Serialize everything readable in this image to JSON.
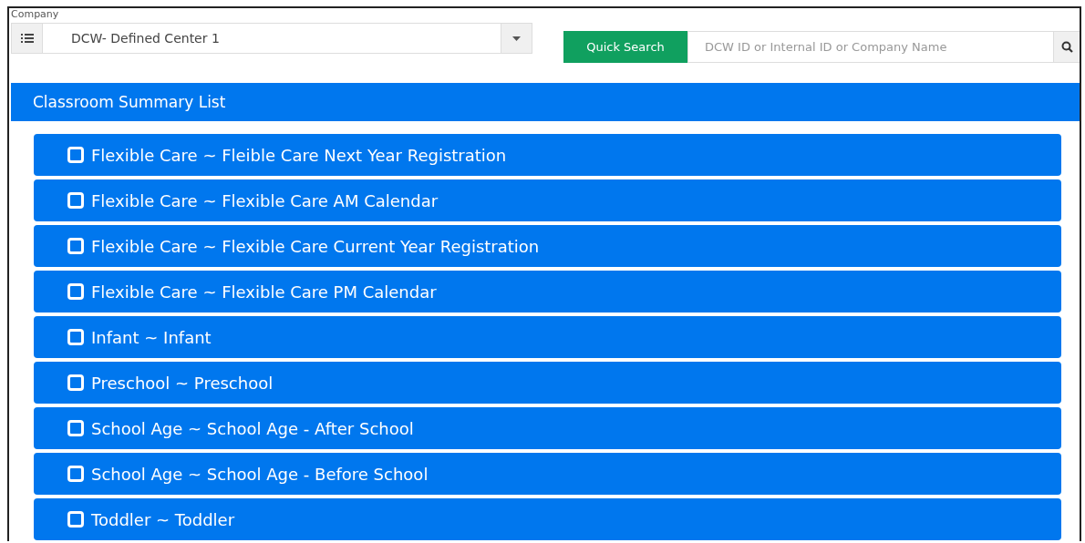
{
  "company": {
    "label": "Company",
    "value": "DCW- Defined Center 1"
  },
  "quick_search": {
    "button": "Quick Search",
    "placeholder": "DCW ID or Internal ID or Company Name"
  },
  "panel": {
    "title": "Classroom Summary List",
    "items": [
      {
        "label": "Flexible Care ~ Fleible Care Next Year Registration",
        "checked": false
      },
      {
        "label": "Flexible Care ~ Flexible Care AM Calendar",
        "checked": false
      },
      {
        "label": "Flexible Care ~ Flexible Care Current Year Registration",
        "checked": false
      },
      {
        "label": "Flexible Care ~ Flexible Care PM Calendar",
        "checked": false
      },
      {
        "label": "Infant ~ Infant",
        "checked": false
      },
      {
        "label": "Preschool ~ Preschool",
        "checked": false
      },
      {
        "label": "School Age ~ School Age - After School",
        "checked": false
      },
      {
        "label": "School Age ~ School Age - Before School",
        "checked": false
      },
      {
        "label": "Toddler ~ Toddler",
        "checked": false
      }
    ]
  }
}
